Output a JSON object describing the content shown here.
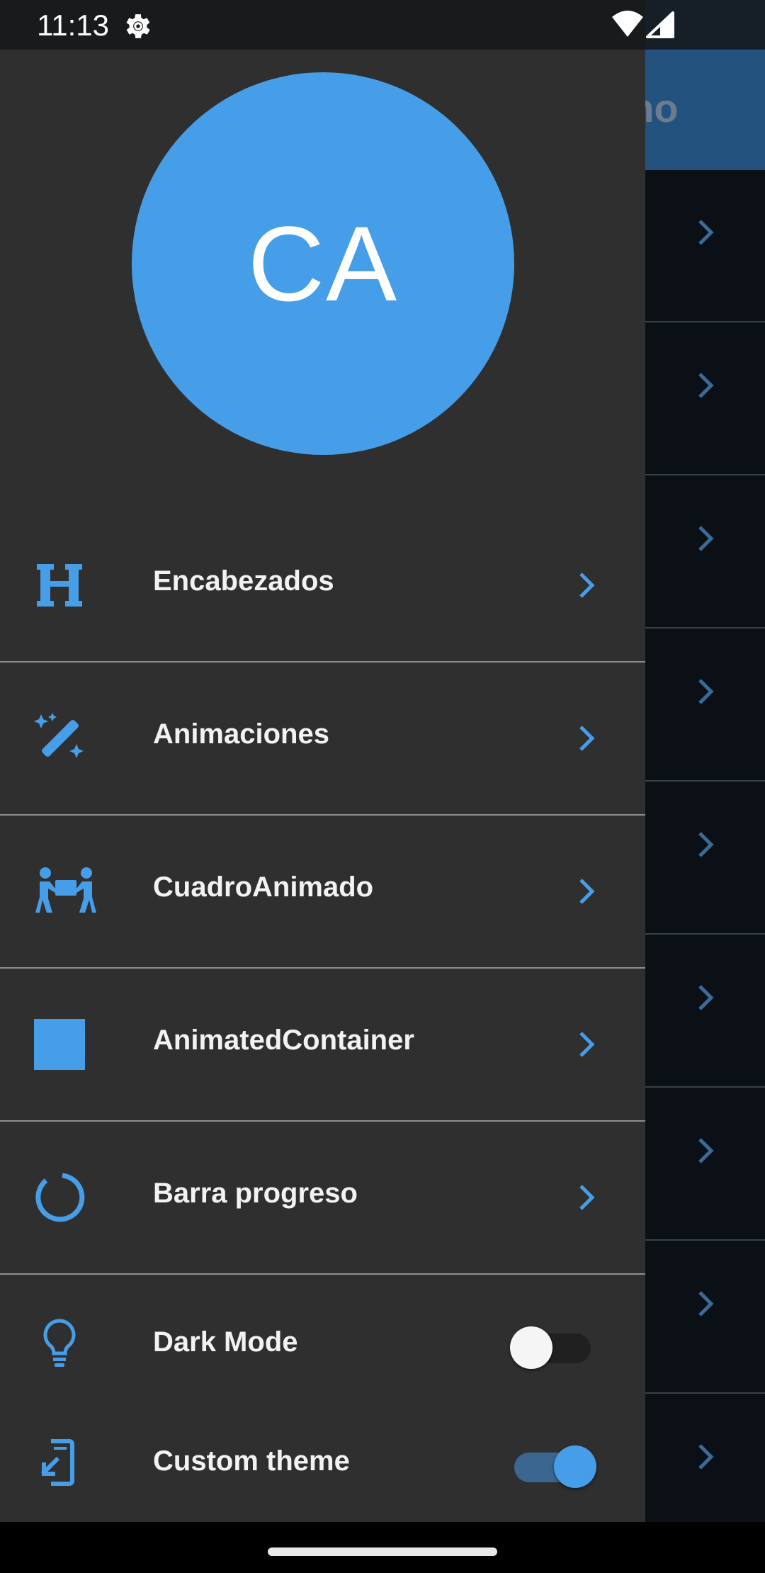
{
  "status_bar": {
    "time": "11:13",
    "settings_icon": "gear-icon",
    "wifi_icon": "wifi-icon",
    "signal_icon": "signal-icon"
  },
  "background_app": {
    "title_fragment": "ono",
    "row_count": 9,
    "chevron_color": "#3b6b96"
  },
  "drawer": {
    "avatar": {
      "initials": "CA",
      "color": "#479ee8"
    },
    "accent": "#479ee8",
    "items": [
      {
        "label": "Encabezados",
        "icon": "heading-icon"
      },
      {
        "label": "Animaciones",
        "icon": "magic-wand-icon"
      },
      {
        "label": "CuadroAnimado",
        "icon": "people-carry-box-icon"
      },
      {
        "label": "AnimatedContainer",
        "icon": "square-icon"
      },
      {
        "label": "Barra progreso",
        "icon": "circle-progress-icon"
      }
    ],
    "toggles": [
      {
        "label": "Dark Mode",
        "icon": "lightbulb-icon",
        "on": false
      },
      {
        "label": "Custom theme",
        "icon": "phone-login-icon",
        "on": true
      }
    ]
  }
}
